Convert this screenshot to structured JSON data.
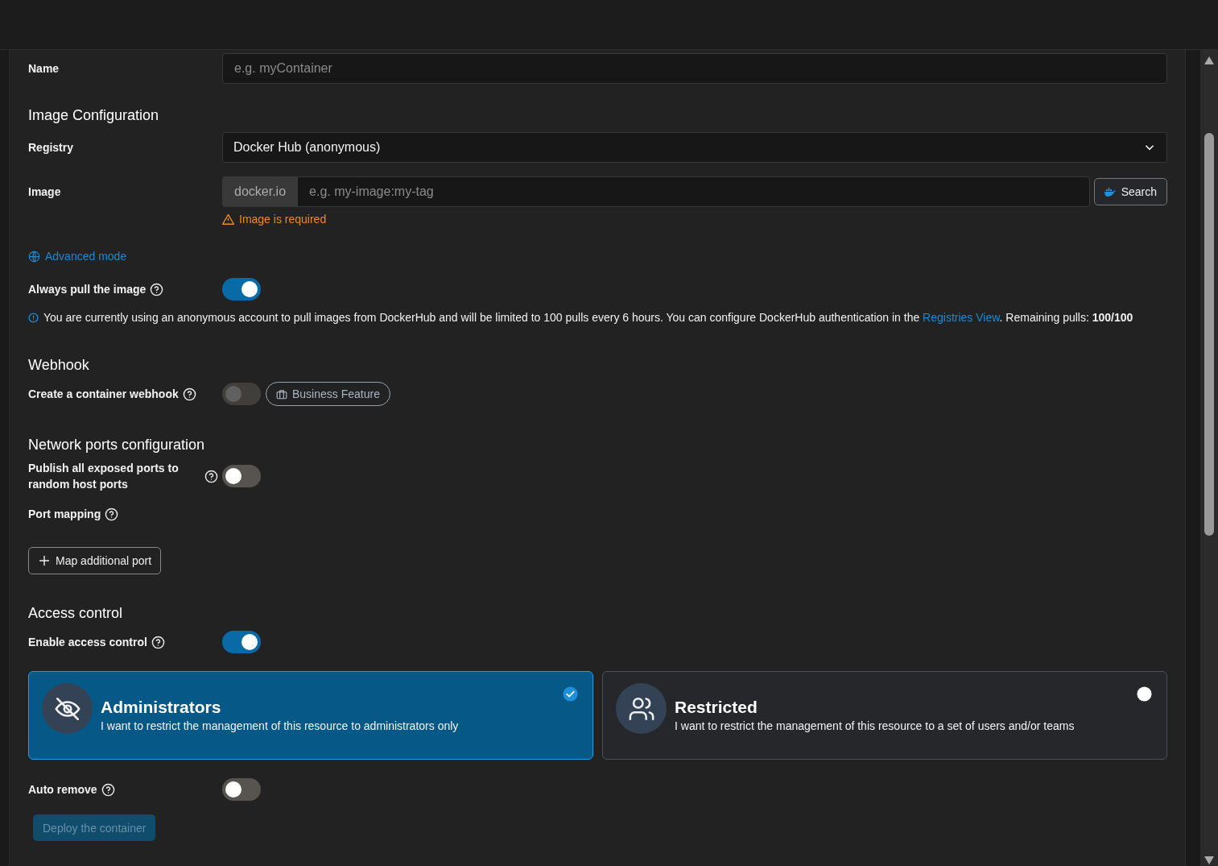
{
  "name_field": {
    "label": "Name",
    "placeholder": "e.g. myContainer"
  },
  "image_configuration": {
    "heading": "Image Configuration",
    "registry": {
      "label": "Registry",
      "value": "Docker Hub (anonymous)"
    },
    "image": {
      "label": "Image",
      "prefix": "docker.io",
      "placeholder": "e.g. my-image:my-tag",
      "search_button": "Search",
      "error": "Image is required"
    },
    "advanced_mode_link": "Advanced mode",
    "always_pull": {
      "label": "Always pull the image",
      "on": true,
      "disabled": false
    },
    "info": {
      "text": "You are currently using an anonymous account to pull images from DockerHub and will be limited to 100 pulls every 6 hours. You can configure DockerHub authentication in the ",
      "link": "Registries View",
      "after": ". Remaining pulls: **100/100**"
    }
  },
  "webhook": {
    "heading": "Webhook",
    "toggle": {
      "label": "Create a container webhook",
      "on": false,
      "disabled": true
    },
    "badge": "Business Feature"
  },
  "network_ports": {
    "heading": "Network ports configuration",
    "publish_all": {
      "label": "Publish all exposed ports to random host ports",
      "on": false,
      "disabled": false
    },
    "port_mapping_label": "Port mapping",
    "map_button": "Map additional port"
  },
  "access_control": {
    "heading": "Access control",
    "enable": {
      "label": "Enable access control",
      "on": true,
      "disabled": false
    },
    "options": [
      {
        "kind": "admins",
        "title": "Administrators",
        "description": "I want to restrict the management of this resource to administrators only",
        "selected": true
      },
      {
        "kind": "restricted",
        "title": "Restricted",
        "description": "I want to restrict the management of this resource to a set of users and/or teams",
        "selected": false
      }
    ]
  },
  "auto_remove": {
    "label": "Auto remove",
    "on": false,
    "disabled": false
  },
  "deploy_button": {
    "label": "Deploy the container",
    "disabled": true
  }
}
